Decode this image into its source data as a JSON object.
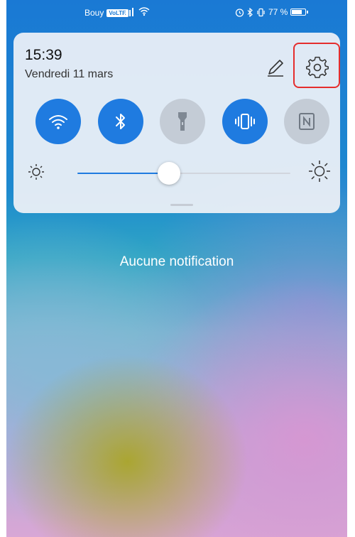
{
  "status_bar": {
    "carrier": "Bouy",
    "volte_badge": "VoLTE",
    "battery_text": "77 %",
    "battery_level": 0.77,
    "icons": [
      "signal-icon",
      "wifi-icon",
      "alarm-icon",
      "bluetooth-icon",
      "vibrate-icon"
    ]
  },
  "panel": {
    "time": "15:39",
    "date": "Vendredi 11 mars",
    "edit_icon": "pencil-icon",
    "settings_icon": "gear-icon",
    "highlight_color": "#e52d2d",
    "toggles": [
      {
        "name": "wifi",
        "icon": "wifi-icon",
        "on": true
      },
      {
        "name": "bluetooth",
        "icon": "bluetooth-icon",
        "on": true
      },
      {
        "name": "flashlight",
        "icon": "flashlight-icon",
        "on": false
      },
      {
        "name": "vibrate",
        "icon": "vibrate-icon",
        "on": true
      },
      {
        "name": "nfc",
        "icon": "nfc-icon",
        "on": false
      }
    ],
    "brightness_level": 0.43,
    "accent_color": "#1f7be0"
  },
  "notifications": {
    "empty_text": "Aucune notification"
  }
}
